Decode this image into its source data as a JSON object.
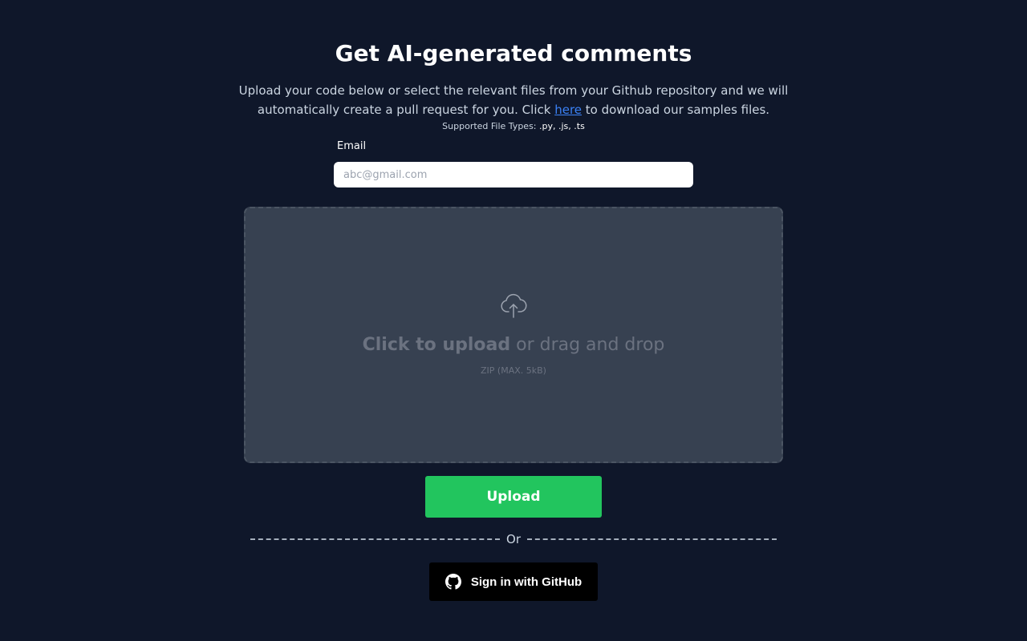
{
  "header": {
    "title": "Get AI-generated comments",
    "description_before_link": "Upload your code below or select the relevant files from your Github repository and we will automatically create a pull request for you. Click ",
    "link_text": "here",
    "description_after_link": " to download our samples files.",
    "supported_label": "Supported File Types: ",
    "supported_types": ".py, .js, .ts"
  },
  "form": {
    "email_label": "Email",
    "email_placeholder": "abc@gmail.com",
    "email_value": ""
  },
  "dropzone": {
    "icon": "cloud-upload-icon",
    "click_text": "Click to upload",
    "drag_text": " or drag and drop",
    "hint": "ZIP (MAX. 5kB)"
  },
  "actions": {
    "upload_label": "Upload",
    "divider_text": "Or",
    "github_icon": "github-icon",
    "github_label": "Sign in with GitHub"
  },
  "colors": {
    "background": "#0f172a",
    "upload_button": "#22c55e",
    "github_button": "#000000",
    "link": "#3b82f6",
    "dropzone": "#374151"
  }
}
